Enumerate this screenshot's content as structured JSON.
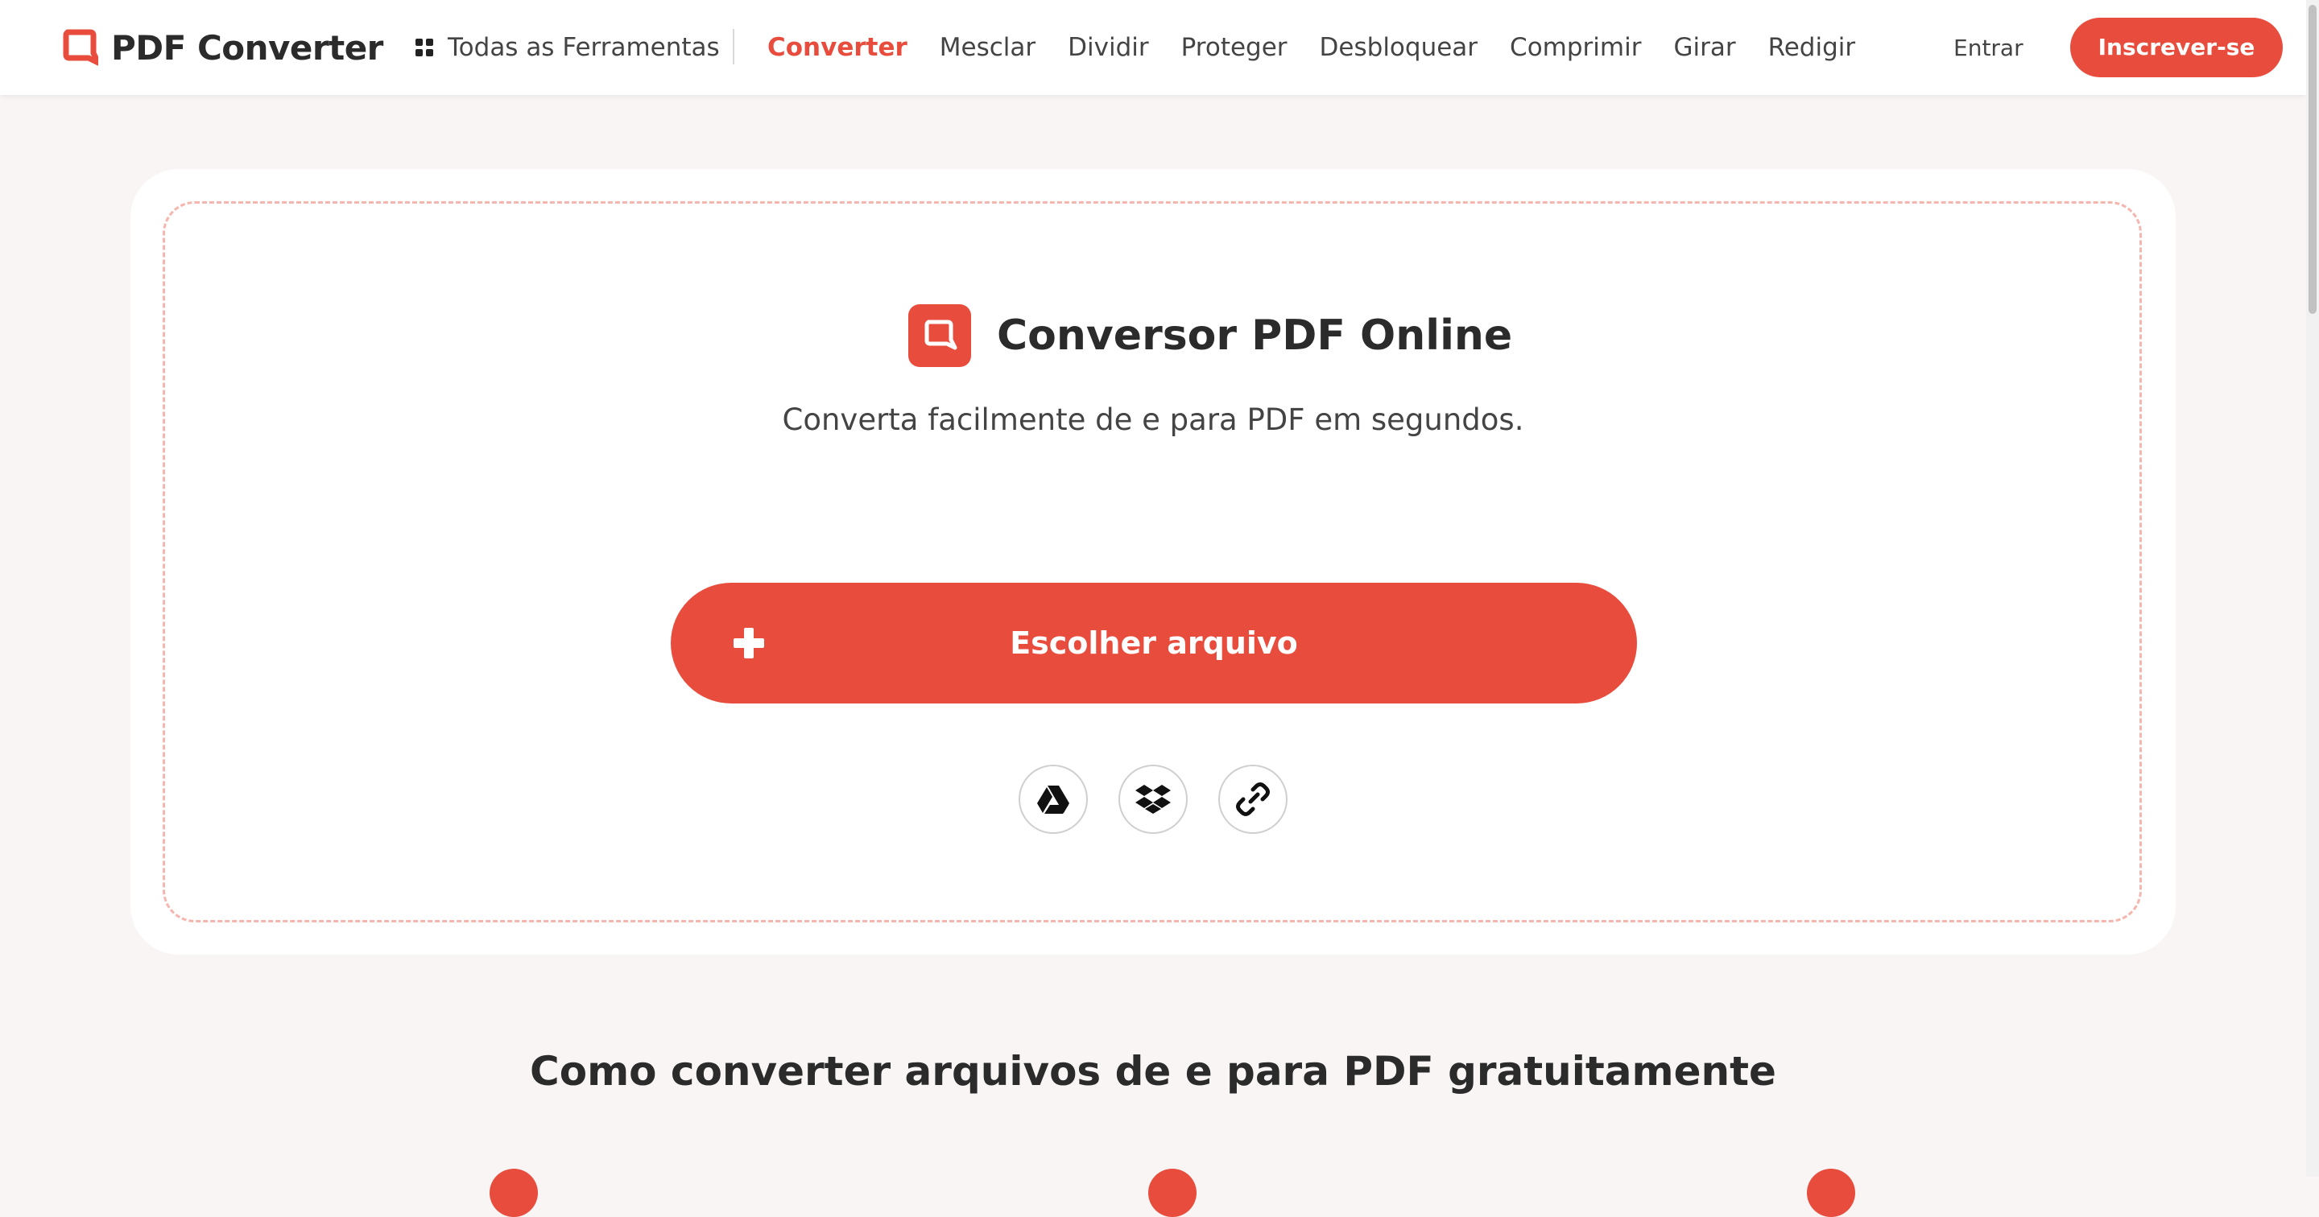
{
  "brand": {
    "name": "PDF Converter",
    "accent_color": "#e84c3d"
  },
  "nav": {
    "all_tools_label": "Todas as Ferramentas",
    "links": [
      {
        "label": "Converter",
        "active": true
      },
      {
        "label": "Mesclar",
        "active": false
      },
      {
        "label": "Dividir",
        "active": false
      },
      {
        "label": "Proteger",
        "active": false
      },
      {
        "label": "Desbloquear",
        "active": false
      },
      {
        "label": "Comprimir",
        "active": false
      },
      {
        "label": "Girar",
        "active": false
      },
      {
        "label": "Redigir",
        "active": false
      }
    ],
    "login_label": "Entrar",
    "signup_label": "Inscrever-se"
  },
  "hero": {
    "title": "Conversor PDF Online",
    "subtitle": "Converta facilmente de e para PDF em segundos.",
    "choose_file_label": "Escolher arquivo",
    "sources": [
      {
        "icon": "google-drive-icon"
      },
      {
        "icon": "dropbox-icon"
      },
      {
        "icon": "link-icon"
      }
    ]
  },
  "how_to": {
    "title": "Como converter arquivos de e para PDF gratuitamente"
  }
}
